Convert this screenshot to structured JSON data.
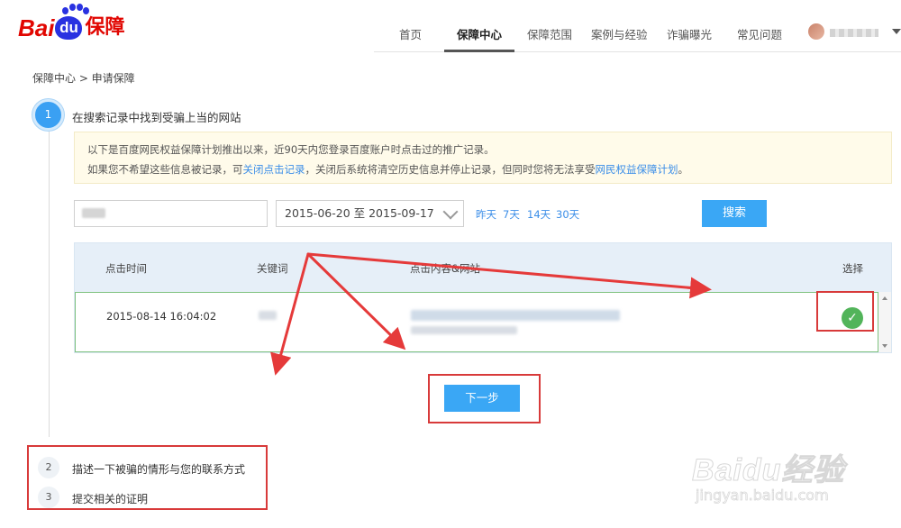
{
  "header": {
    "logo_bai": "Bai",
    "logo_du": "du",
    "logo_suffix": "保障",
    "nav": [
      {
        "label": "首页",
        "active": false
      },
      {
        "label": "保障中心",
        "active": true
      },
      {
        "label": "保障范围",
        "active": false
      },
      {
        "label": "案例与经验",
        "active": false
      },
      {
        "label": "诈骗曝光",
        "active": false
      },
      {
        "label": "常见问题",
        "active": false
      }
    ],
    "user_icon": "avatar-icon",
    "menu_icon": "caret-down-icon"
  },
  "breadcrumb": "保障中心 > 申请保障",
  "step1": {
    "number": "1",
    "title": "在搜索记录中找到受骗上当的网站"
  },
  "notice": {
    "line1": "以下是百度网民权益保障计划推出以来，近90天内您登录百度账户时点击过的推广记录。",
    "line2_a": "如果您不希望这些信息被记录，可",
    "line2_link1": "关闭点击记录",
    "line2_b": "，关闭后系统将清空历史信息并停止记录，但同时您将无法享受",
    "line2_link2": "网民权益保障计划",
    "line2_c": "。"
  },
  "filters": {
    "date_range": "2015-06-20 至 2015-09-17",
    "quick_ranges": [
      "昨天",
      "7天",
      "14天",
      "30天"
    ],
    "search_label": "搜索"
  },
  "table": {
    "headers": {
      "time": "点击时间",
      "keyword": "关键词",
      "content": "点击内容&网站",
      "select": "选择"
    },
    "rows": [
      {
        "time": "2015-08-14 16:04:02",
        "selected": true
      }
    ]
  },
  "next_label": "下一步",
  "step2": {
    "number": "2",
    "title": "描述一下被骗的情形与您的联系方式"
  },
  "step3": {
    "number": "3",
    "title": "提交相关的证明"
  },
  "watermark": {
    "logo": "Baidu经验",
    "url": "jingyan.baidu.com"
  },
  "colors": {
    "primary": "#3aa7f5",
    "annotation_red": "#d83a3a",
    "check_green": "#52b45a",
    "link_blue": "#3b8ee8"
  }
}
